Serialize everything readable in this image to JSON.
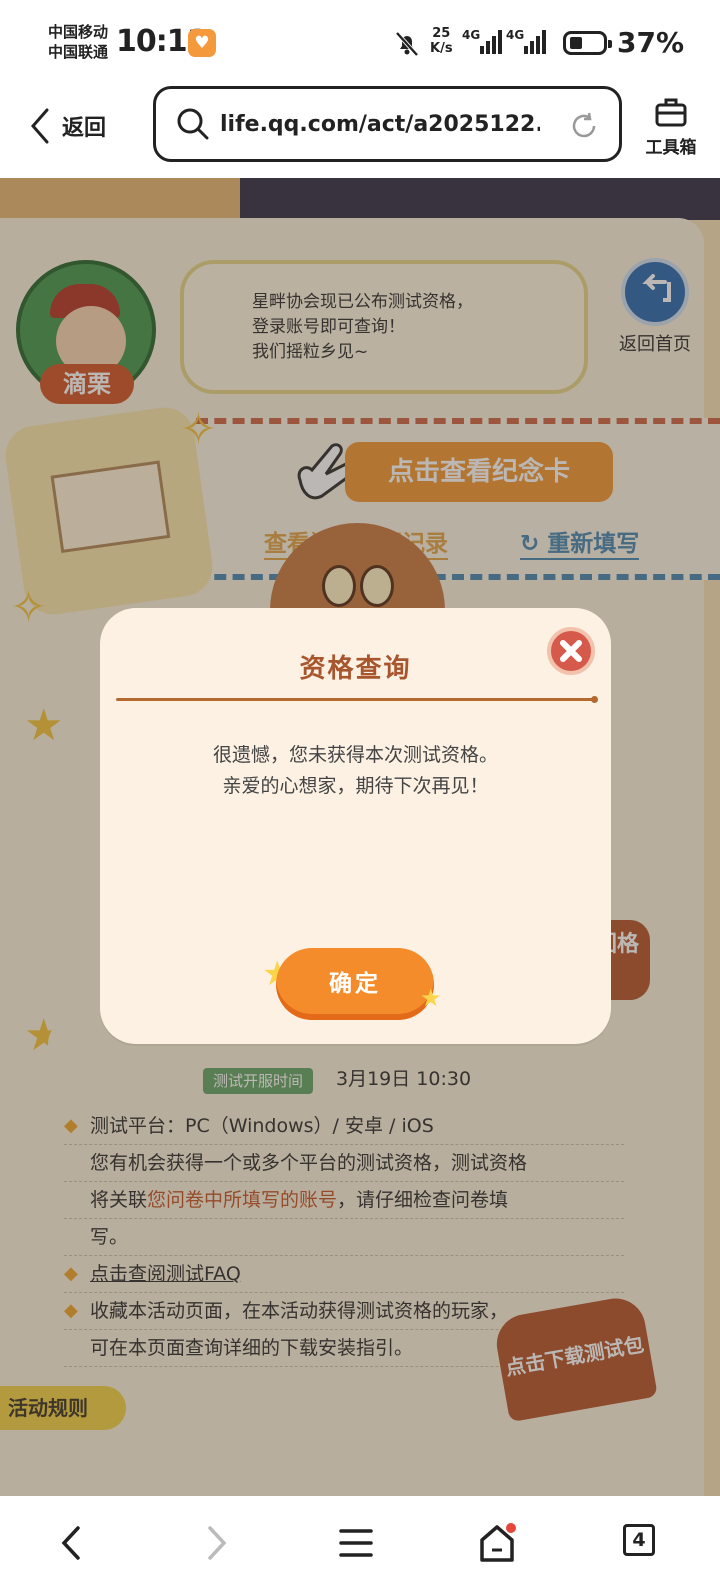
{
  "status_bar": {
    "carrier_1": "中国移动",
    "carrier_2": "中国联通",
    "time": "10:11",
    "net_speed_value": "25",
    "net_speed_unit": "K/s",
    "signal_1_label": "4G",
    "signal_2_label": "4G",
    "battery": "37%"
  },
  "browser": {
    "back_label": "返回",
    "url": "life.qq.com/act/a2025122...",
    "toolbox_label": "工具箱",
    "tab_count": "4"
  },
  "page": {
    "character_name": "滴栗",
    "speech_bubble": [
      "星畔协会现已公布测试资格，",
      "登录账号即可查询！",
      "我们摇粒乡见~"
    ],
    "home_label": "返回首页",
    "memorial_card_button": "点击查看纪念卡",
    "view_record_link": "查看问卷填写记录",
    "refill_link": "重新填写",
    "test_open_tag": "测试开服时间",
    "test_open_time": "3月19日 10:30",
    "platform_line": "测试平台：PC（Windows）/ 安卓 / iOS",
    "qualification_text_1": "您有机会获得一个或多个平台的测试资格，测试资格",
    "qualification_text_2a": "将关联",
    "qualification_text_2b": "您问卷中所填写的账号",
    "qualification_text_2c": "，请仔细检查问卷填",
    "qualification_text_3": "写。",
    "faq_link": "点击查阅测试FAQ",
    "bookmark_text_1": "收藏本活动页面，在本活动获得测试资格的玩家，",
    "bookmark_text_2": "可在本页面查询详细的下载安装指引。",
    "download_button": "点击下载测试包",
    "rules_tab": "活动规则",
    "side_tag": "回格"
  },
  "modal": {
    "title": "资格查询",
    "message_line_1": "很遗憾，您未获得本次测试资格。",
    "message_line_2": "亲爱的心想家，期待下次再见！",
    "confirm_label": "确定"
  },
  "colors": {
    "accent_orange": "#f58c2c",
    "title_brown": "#a8562e",
    "close_red": "#d65a4c"
  }
}
